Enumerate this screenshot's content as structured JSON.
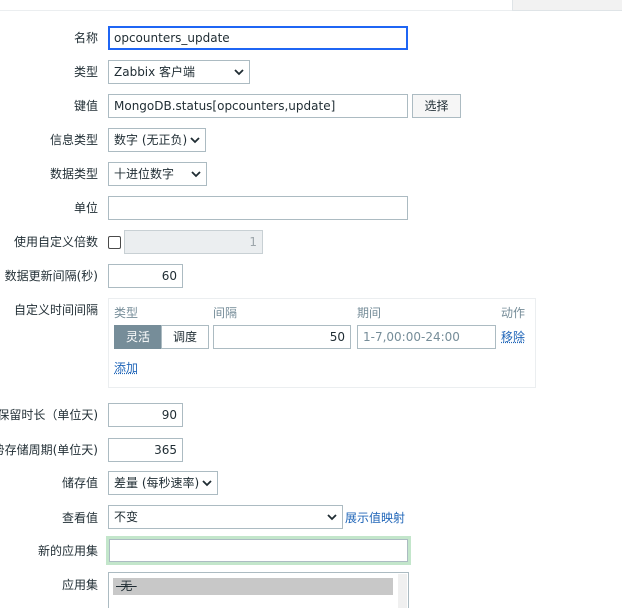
{
  "form": {
    "name": {
      "label": "名称",
      "value": "opcounters_update"
    },
    "type": {
      "label": "类型",
      "value": "Zabbix 客户端"
    },
    "key": {
      "label": "键值",
      "value": "MongoDB.status[opcounters,update]",
      "select_label": "选择"
    },
    "info_type": {
      "label": "信息类型",
      "value": "数字 (无正负)"
    },
    "data_type": {
      "label": "数据类型",
      "value": "十进位数字"
    },
    "units": {
      "label": "单位",
      "value": ""
    },
    "multiplier": {
      "label": "使用自定义倍数",
      "value": "1",
      "checked": false
    },
    "update_interval": {
      "label": "数据更新间隔(秒)",
      "value": "60"
    },
    "custom_intervals": {
      "label": "自定义时间间隔",
      "columns": [
        "类型",
        "间隔",
        "期间",
        "动作"
      ],
      "row": {
        "type_flexible": "灵活",
        "type_scheduling": "调度",
        "interval": "50",
        "period": "1-7,00:00-24:00",
        "remove": "移除"
      },
      "add": "添加"
    },
    "history": {
      "label": "保留时长（单位天)",
      "value": "90"
    },
    "trends": {
      "label": "趋势存储周期(单位天)",
      "value": "365"
    },
    "store_value": {
      "label": "储存值",
      "value": "差量 (每秒速率)"
    },
    "show_value": {
      "label": "查看值",
      "value": "不变",
      "mapping_link": "展示值映射"
    },
    "new_application": {
      "label": "新的应用集",
      "value": ""
    },
    "applications": {
      "label": "应用集",
      "options": [
        "-无-"
      ]
    }
  },
  "colors": {
    "accent": "#1f65f4",
    "link": "#1f65b8",
    "segment_active": "#768d99"
  }
}
